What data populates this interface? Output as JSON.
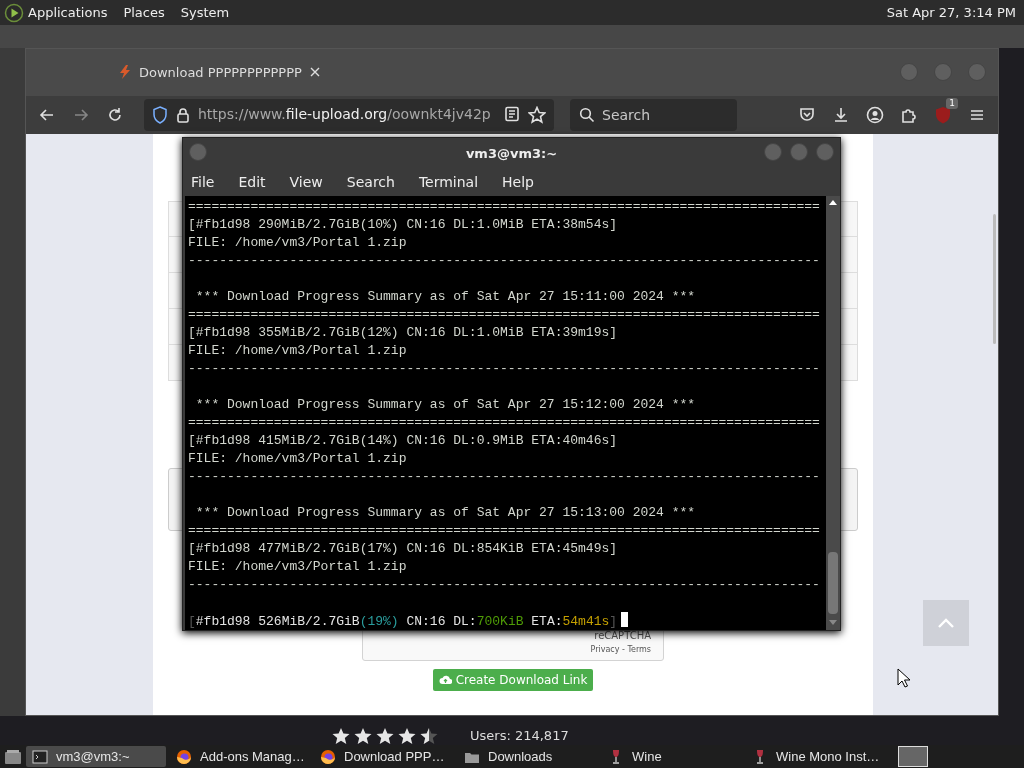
{
  "top_panel": {
    "menus": [
      "Applications",
      "Places",
      "System"
    ],
    "clock": "Sat Apr 27, 3:14 PM"
  },
  "background_window": {
    "rating": {
      "stars": 4.5
    },
    "users": "Users: 214,817"
  },
  "browser": {
    "tab": {
      "title": "Download PPPPPPPPPPPP"
    },
    "url": {
      "prefix": "https://www.",
      "domain": "file-upload.org",
      "path": "/oownkt4jv42p"
    },
    "search": {
      "placeholder": "Search"
    },
    "extension_badge": "1",
    "page": {
      "recaptcha": {
        "brand": "reCAPTCHA",
        "links": "Privacy - Terms"
      },
      "button": "Create Download Link"
    }
  },
  "terminal": {
    "title": "vm3@vm3:~",
    "menu": [
      "File",
      "Edit",
      "View",
      "Search",
      "Terminal",
      "Help"
    ],
    "lines": [
      {
        "kind": "text",
        "text": "================================================================================="
      },
      {
        "kind": "text",
        "text": "[#fb1d98 290MiB/2.7GiB(10%) CN:16 DL:1.0MiB ETA:38m54s]"
      },
      {
        "kind": "text",
        "text": "FILE: /home/vm3/Portal 1.zip"
      },
      {
        "kind": "text",
        "text": "---------------------------------------------------------------------------------"
      },
      {
        "kind": "blank"
      },
      {
        "kind": "text",
        "text": " *** Download Progress Summary as of Sat Apr 27 15:11:00 2024 ***"
      },
      {
        "kind": "text",
        "text": "================================================================================="
      },
      {
        "kind": "text",
        "text": "[#fb1d98 355MiB/2.7GiB(12%) CN:16 DL:1.0MiB ETA:39m19s]"
      },
      {
        "kind": "text",
        "text": "FILE: /home/vm3/Portal 1.zip"
      },
      {
        "kind": "text",
        "text": "---------------------------------------------------------------------------------"
      },
      {
        "kind": "blank"
      },
      {
        "kind": "text",
        "text": " *** Download Progress Summary as of Sat Apr 27 15:12:00 2024 ***"
      },
      {
        "kind": "text",
        "text": "================================================================================="
      },
      {
        "kind": "text",
        "text": "[#fb1d98 415MiB/2.7GiB(14%) CN:16 DL:0.9MiB ETA:40m46s]"
      },
      {
        "kind": "text",
        "text": "FILE: /home/vm3/Portal 1.zip"
      },
      {
        "kind": "text",
        "text": "---------------------------------------------------------------------------------"
      },
      {
        "kind": "blank"
      },
      {
        "kind": "text",
        "text": " *** Download Progress Summary as of Sat Apr 27 15:13:00 2024 ***"
      },
      {
        "kind": "text",
        "text": "================================================================================="
      },
      {
        "kind": "text",
        "text": "[#fb1d98 477MiB/2.7GiB(17%) CN:16 DL:854KiB ETA:45m49s]"
      },
      {
        "kind": "text",
        "text": "FILE: /home/vm3/Portal 1.zip"
      },
      {
        "kind": "text",
        "text": "---------------------------------------------------------------------------------"
      },
      {
        "kind": "blank"
      },
      {
        "kind": "status",
        "cursor": true,
        "segments": [
          {
            "text": "[",
            "color": "#555555"
          },
          {
            "text": "#fb1d98 526MiB/2.7GiB",
            "color": "#e4e4e4"
          },
          {
            "text": "(19%)",
            "color": "#2a9d9d"
          },
          {
            "text": " CN:16 DL:",
            "color": "#e4e4e4"
          },
          {
            "text": "700KiB",
            "color": "#4e9a06"
          },
          {
            "text": " ETA:",
            "color": "#e4e4e4"
          },
          {
            "text": "54m41s",
            "color": "#c4a000"
          },
          {
            "text": "]",
            "color": "#555555"
          }
        ]
      }
    ]
  },
  "taskbar": {
    "items": [
      {
        "label": "vm3@vm3:~",
        "kind": "terminal",
        "selected": true
      },
      {
        "label": "Add-ons Manag…",
        "kind": "firefox",
        "selected": false
      },
      {
        "label": "Download PPP…",
        "kind": "firefox",
        "selected": false
      },
      {
        "label": "Downloads",
        "kind": "folder",
        "selected": false
      },
      {
        "label": "Wine",
        "kind": "wine",
        "selected": false
      },
      {
        "label": "Wine Mono Inst…",
        "kind": "wine",
        "selected": false
      }
    ]
  }
}
